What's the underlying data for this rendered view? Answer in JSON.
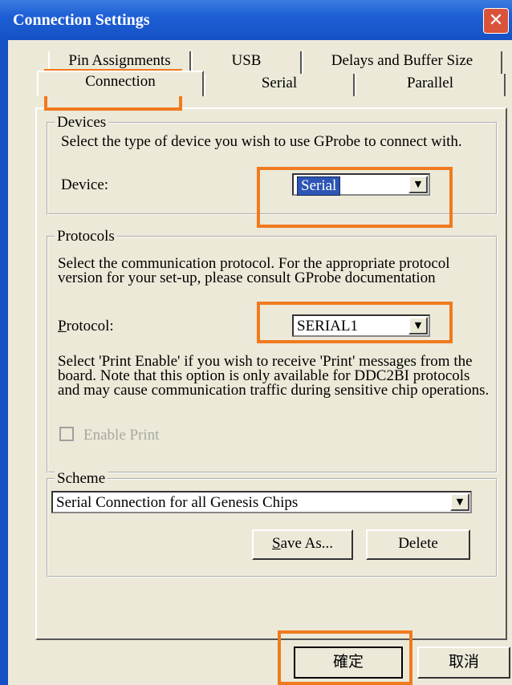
{
  "window": {
    "title": "Connection Settings",
    "close_glyph": "✕"
  },
  "tabs": {
    "row1": [
      "Pin Assignments",
      "USB",
      "Delays and Buffer Size"
    ],
    "row2": [
      "Connection",
      "Serial",
      "Parallel"
    ],
    "active": "Connection"
  },
  "devices": {
    "legend": "Devices",
    "description": "Select the type of device you wish to use GProbe to connect with.",
    "device_label": "Device:",
    "device_value": "Serial"
  },
  "protocols": {
    "legend": "Protocols",
    "description": "Select the communication protocol.  For the appropriate protocol version for your set-up, please consult GProbe documentation",
    "protocol_label_accel": "P",
    "protocol_label_rest": "rotocol:",
    "protocol_value": "SERIAL1",
    "print_note": "Select 'Print Enable' if you wish to receive 'Print' messages from the board.  Note that this option is only available for DDC2BI protocols and may cause communication traffic during sensitive chip operations.",
    "enable_print_label": "Enable Print",
    "enable_print_checked": false
  },
  "scheme": {
    "legend": "Scheme",
    "value": "Serial Connection for all Genesis Chips",
    "save_as_accel": "S",
    "save_as_rest": "ave As...",
    "delete_label": "Delete"
  },
  "footer": {
    "ok_label": "確定",
    "cancel_label": "取消"
  },
  "colors": {
    "titlebar": "#1e5fd6",
    "dialog_bg": "#ece9d8",
    "highlight": "#f07a1f",
    "selection": "#2d55b5",
    "close": "#d9533a"
  }
}
